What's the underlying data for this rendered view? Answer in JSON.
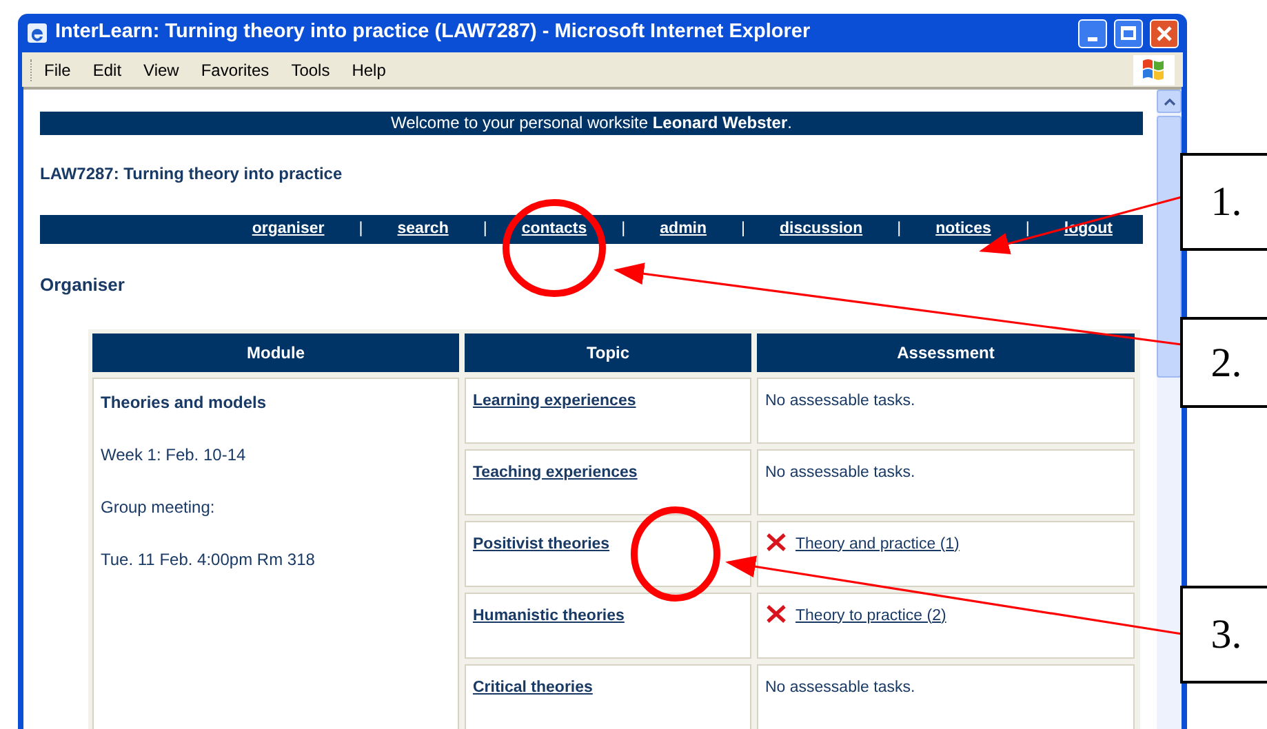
{
  "window": {
    "title": "InterLearn: Turning theory into practice (LAW7287) - Microsoft Internet Explorer"
  },
  "menu": [
    "File",
    "Edit",
    "View",
    "Favorites",
    "Tools",
    "Help"
  ],
  "banner": "Welcome to your personal worksite **Leonard Webster**.",
  "course_title": "LAW7287: Turning theory into practice",
  "nav": [
    {
      "kind": "link",
      "label": "organiser"
    },
    {
      "kind": "separator",
      "label": "|"
    },
    {
      "kind": "link",
      "label": "search"
    },
    {
      "kind": "separator",
      "label": "|"
    },
    {
      "kind": "link",
      "label": "contacts"
    },
    {
      "kind": "separator",
      "label": "|"
    },
    {
      "kind": "link",
      "label": "admin"
    },
    {
      "kind": "separator",
      "label": "|"
    },
    {
      "kind": "link",
      "label": "discussion"
    },
    {
      "kind": "separator",
      "label": "|"
    },
    {
      "kind": "link",
      "label": "notices"
    },
    {
      "kind": "separator",
      "label": "|"
    },
    {
      "kind": "link",
      "label": "logout"
    }
  ],
  "section_heading": "Organiser",
  "table": {
    "columns": [
      "Module",
      "Topic",
      "Assessment"
    ],
    "module": {
      "title": "Theories and models",
      "lines": [
        "Week 1: Feb. 10-14",
        "Group meeting:",
        "Tue. 11 Feb. 4:00pm Rm 318"
      ]
    },
    "rows": [
      {
        "topic": "Learning experiences",
        "assessment": {
          "kind": "none",
          "text": "No assessable tasks."
        }
      },
      {
        "topic": "Teaching experiences",
        "assessment": {
          "kind": "none",
          "text": "No assessable tasks."
        }
      },
      {
        "topic": "Positivist theories",
        "assessment": {
          "kind": "task",
          "text": "Theory and practice (1)"
        }
      },
      {
        "topic": "Humanistic theories",
        "assessment": {
          "kind": "task",
          "text": "Theory to practice (2)"
        }
      },
      {
        "topic": "Critical theories",
        "assessment": {
          "kind": "none",
          "text": "No assessable tasks."
        }
      }
    ]
  },
  "callouts": [
    {
      "label": "1."
    },
    {
      "label": "2."
    },
    {
      "label": "3."
    }
  ]
}
